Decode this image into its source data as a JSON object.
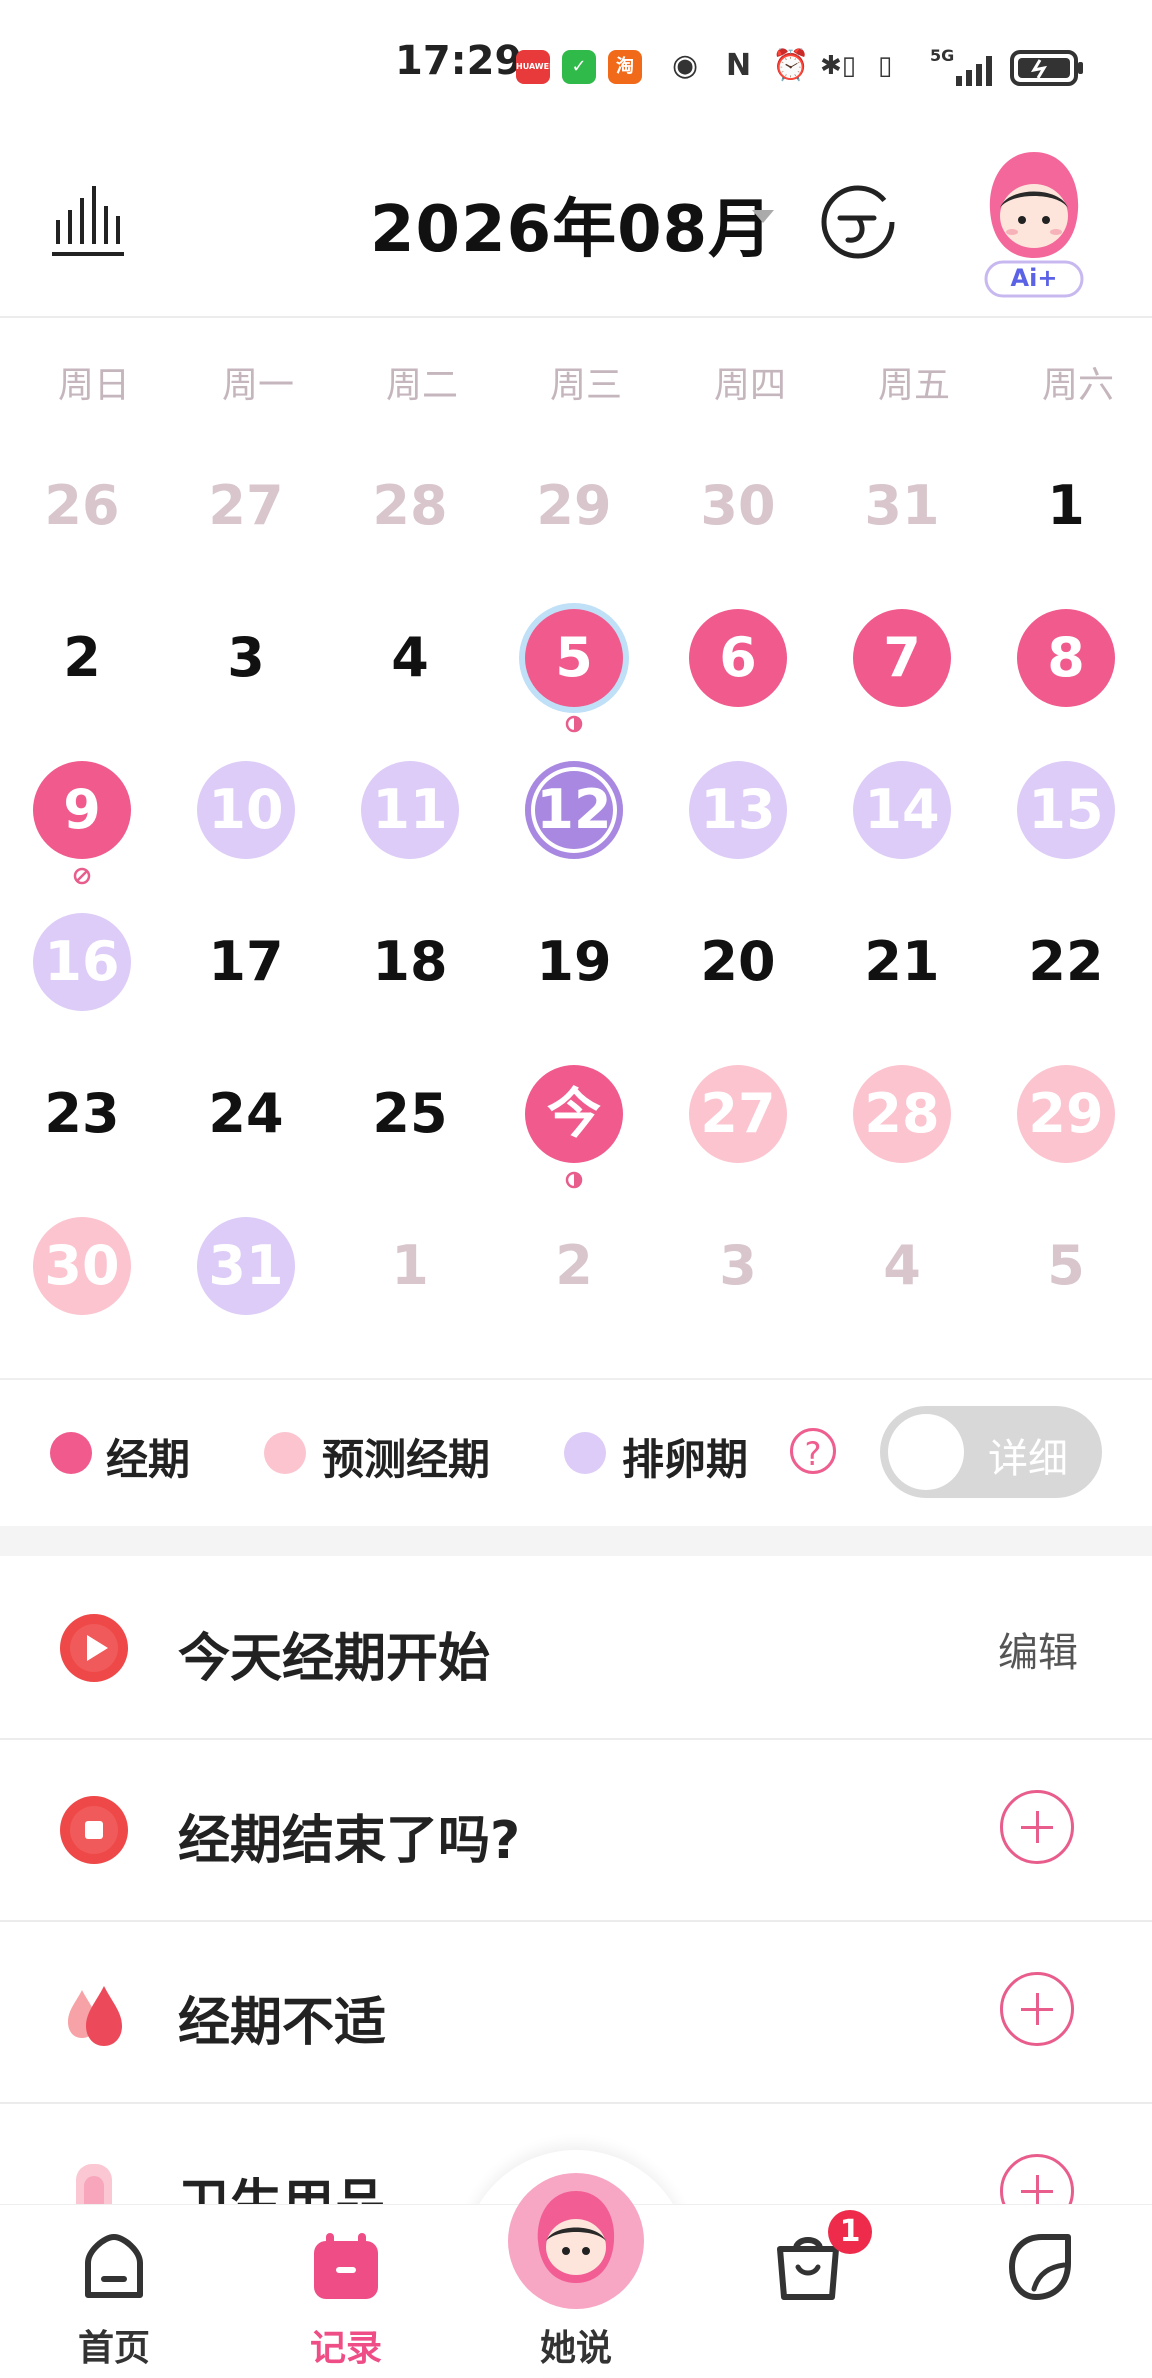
{
  "status_bar": {
    "time": "17:29",
    "apps": [
      {
        "name": "huawei-app-icon",
        "label": "HUAWEI",
        "color": "#e83a3a"
      },
      {
        "name": "wechat-app-icon",
        "label": "✓",
        "color": "#2fba4a"
      },
      {
        "name": "taobao-app-icon",
        "label": "淘",
        "color": "#f06a1a"
      }
    ],
    "network": "5G"
  },
  "header": {
    "month_title": "2026年08月",
    "ai_badge": "Ai+"
  },
  "weekdays": [
    "周日",
    "周一",
    "周二",
    "周三",
    "周四",
    "周五",
    "周六"
  ],
  "calendar": {
    "days": [
      {
        "label": "26",
        "state": "other"
      },
      {
        "label": "27",
        "state": "other"
      },
      {
        "label": "28",
        "state": "other"
      },
      {
        "label": "29",
        "state": "other"
      },
      {
        "label": "30",
        "state": "other"
      },
      {
        "label": "31",
        "state": "other"
      },
      {
        "label": "1",
        "state": "normal"
      },
      {
        "label": "2",
        "state": "normal"
      },
      {
        "label": "3",
        "state": "normal"
      },
      {
        "label": "4",
        "state": "normal"
      },
      {
        "label": "5",
        "state": "period",
        "selected": true,
        "mark": "moon"
      },
      {
        "label": "6",
        "state": "period"
      },
      {
        "label": "7",
        "state": "period"
      },
      {
        "label": "8",
        "state": "period"
      },
      {
        "label": "9",
        "state": "period",
        "mark": "ban"
      },
      {
        "label": "10",
        "state": "ovulation"
      },
      {
        "label": "11",
        "state": "ovulation"
      },
      {
        "label": "12",
        "state": "ovulation-day"
      },
      {
        "label": "13",
        "state": "ovulation"
      },
      {
        "label": "14",
        "state": "ovulation"
      },
      {
        "label": "15",
        "state": "ovulation"
      },
      {
        "label": "16",
        "state": "ovulation"
      },
      {
        "label": "17",
        "state": "normal"
      },
      {
        "label": "18",
        "state": "normal"
      },
      {
        "label": "19",
        "state": "normal"
      },
      {
        "label": "20",
        "state": "normal"
      },
      {
        "label": "21",
        "state": "normal"
      },
      {
        "label": "22",
        "state": "normal"
      },
      {
        "label": "23",
        "state": "normal"
      },
      {
        "label": "24",
        "state": "normal"
      },
      {
        "label": "25",
        "state": "normal"
      },
      {
        "label": "今",
        "state": "today",
        "mark": "moon"
      },
      {
        "label": "27",
        "state": "predicted"
      },
      {
        "label": "28",
        "state": "predicted"
      },
      {
        "label": "29",
        "state": "predicted"
      },
      {
        "label": "30",
        "state": "predicted"
      },
      {
        "label": "31",
        "state": "ovulation"
      },
      {
        "label": "1",
        "state": "other"
      },
      {
        "label": "2",
        "state": "other"
      },
      {
        "label": "3",
        "state": "other"
      },
      {
        "label": "4",
        "state": "other"
      },
      {
        "label": "5",
        "state": "other"
      }
    ],
    "colors": {
      "period": "#f05a8c",
      "predicted": "#fbc4cf",
      "ovulation": "#dcccf7",
      "ovulation_day": "#a888e0",
      "other_text": "#d8c6cc",
      "normal_text": "#111111",
      "selected_ring": "#bfe0f7"
    }
  },
  "legend": {
    "items": [
      {
        "label": "经期",
        "color": "#f05a8c"
      },
      {
        "label": "预测经期",
        "color": "#fbc4cf"
      },
      {
        "label": "排卵期",
        "color": "#dcccf7"
      }
    ],
    "help_symbol": "?",
    "toggle_label": "详细",
    "toggle_on": false
  },
  "records": [
    {
      "label": "今天经期开始",
      "icon": "play-icon",
      "action": "编辑"
    },
    {
      "label": "经期结束了吗?",
      "icon": "stop-icon",
      "action": "add"
    },
    {
      "label": "经期不适",
      "icon": "drops-icon",
      "action": "add"
    },
    {
      "label": "卫生用品",
      "icon": "pad-icon",
      "action": "add"
    }
  ],
  "bottom_nav": {
    "items": [
      {
        "label": "首页",
        "icon": "home-icon",
        "active": false
      },
      {
        "label": "记录",
        "icon": "calendar-icon",
        "active": true
      },
      {
        "label": "她说",
        "icon": "mascot-icon",
        "active": false
      },
      {
        "label": "",
        "icon": "shop-bag-icon",
        "active": false
      },
      {
        "label": "",
        "icon": "sticker-icon",
        "active": false
      }
    ],
    "bag_badge": "1",
    "active_color": "#ee4d86"
  }
}
